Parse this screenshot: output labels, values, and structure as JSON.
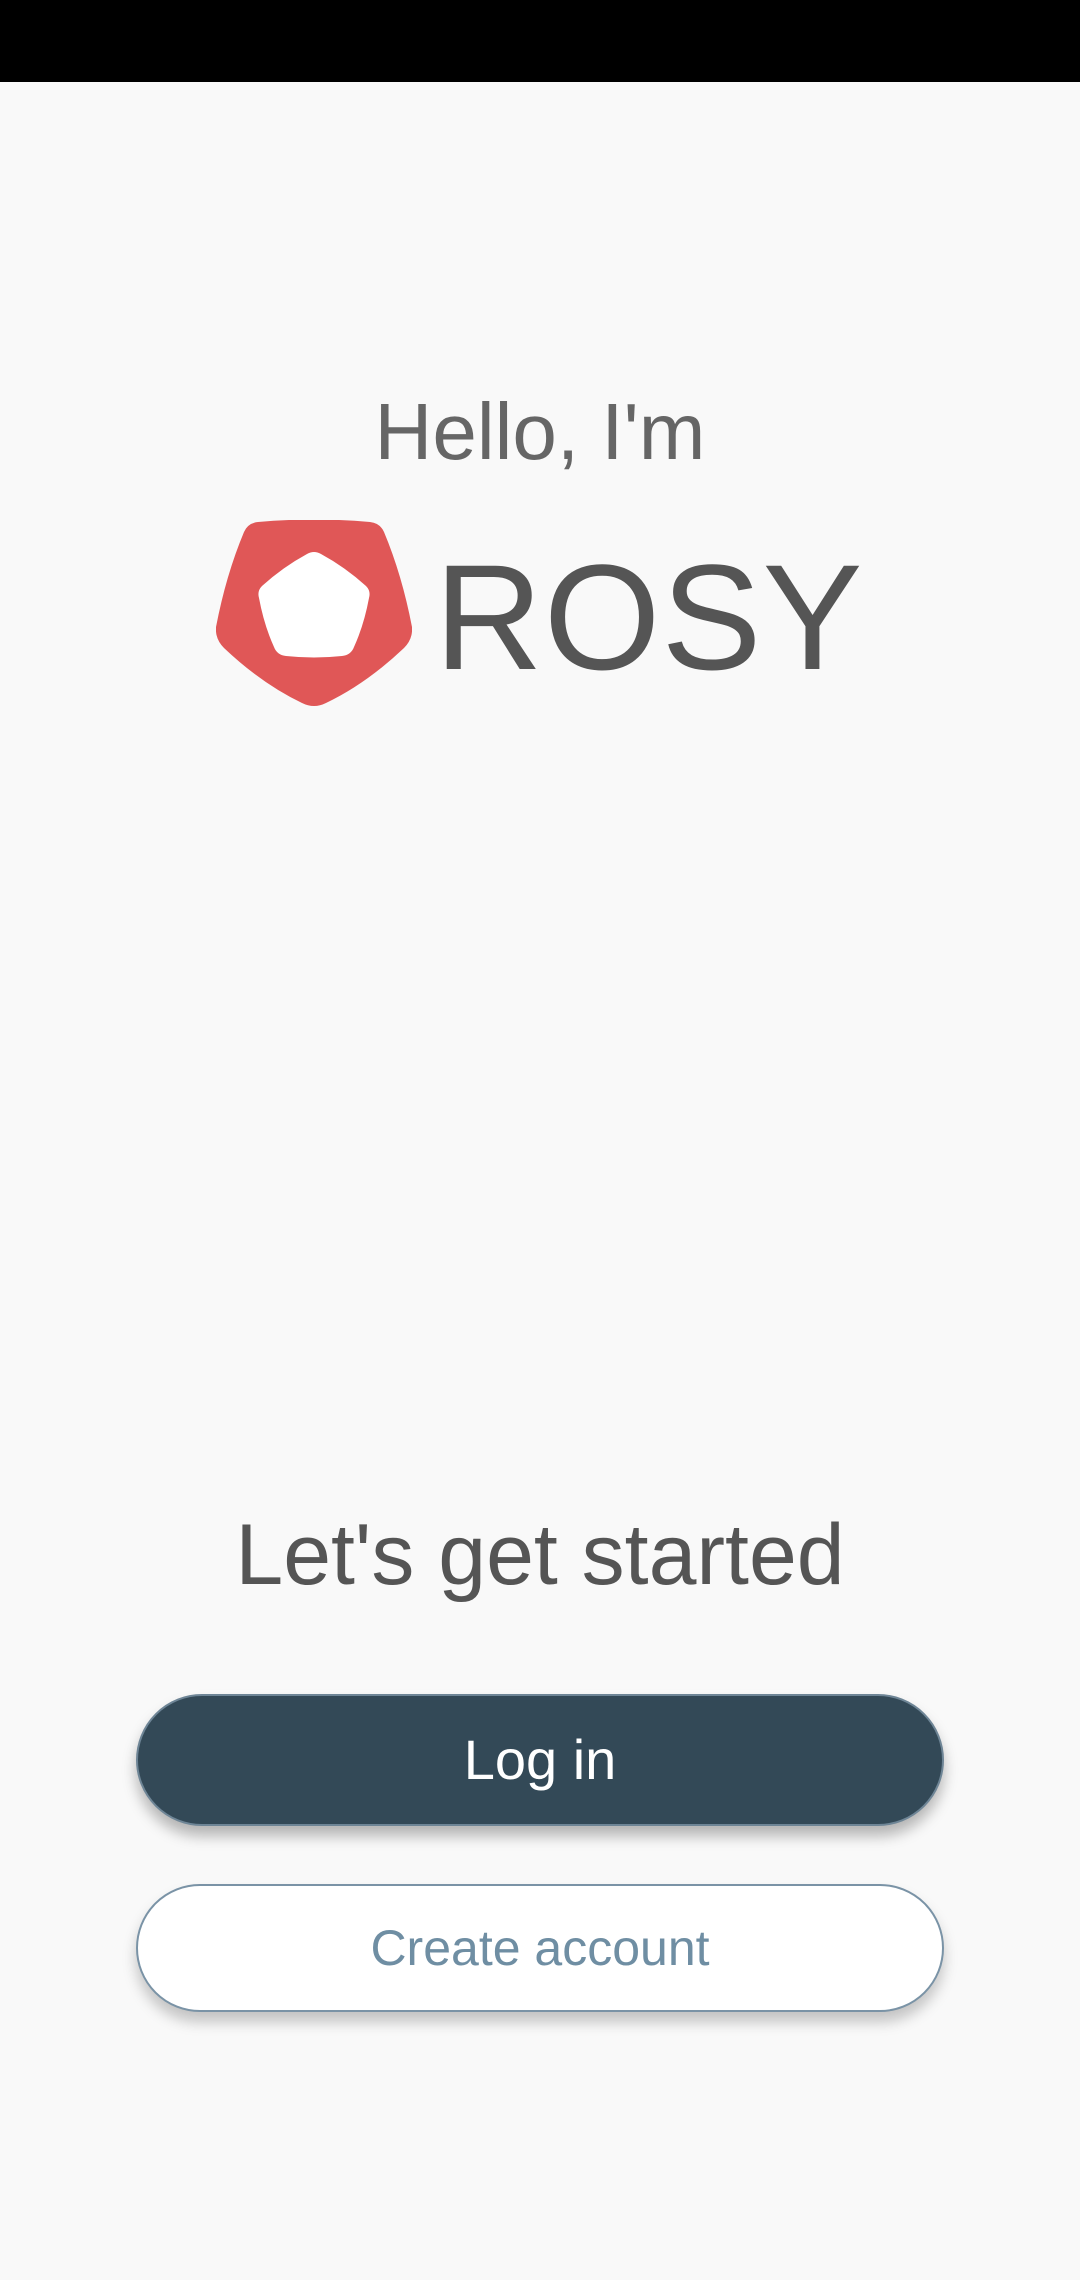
{
  "greeting": "Hello, I'm",
  "brand": {
    "name": "ROSY",
    "logo_icon": "rosy-pentagon-logo-icon",
    "logo_color": "#e05757"
  },
  "tagline": "Let's get started",
  "buttons": {
    "login_label": "Log in",
    "create_label": "Create account"
  },
  "colors": {
    "background": "#f9f9f9",
    "primary_button": "#334957",
    "secondary_text": "#6f8ea3",
    "text": "#555555"
  }
}
